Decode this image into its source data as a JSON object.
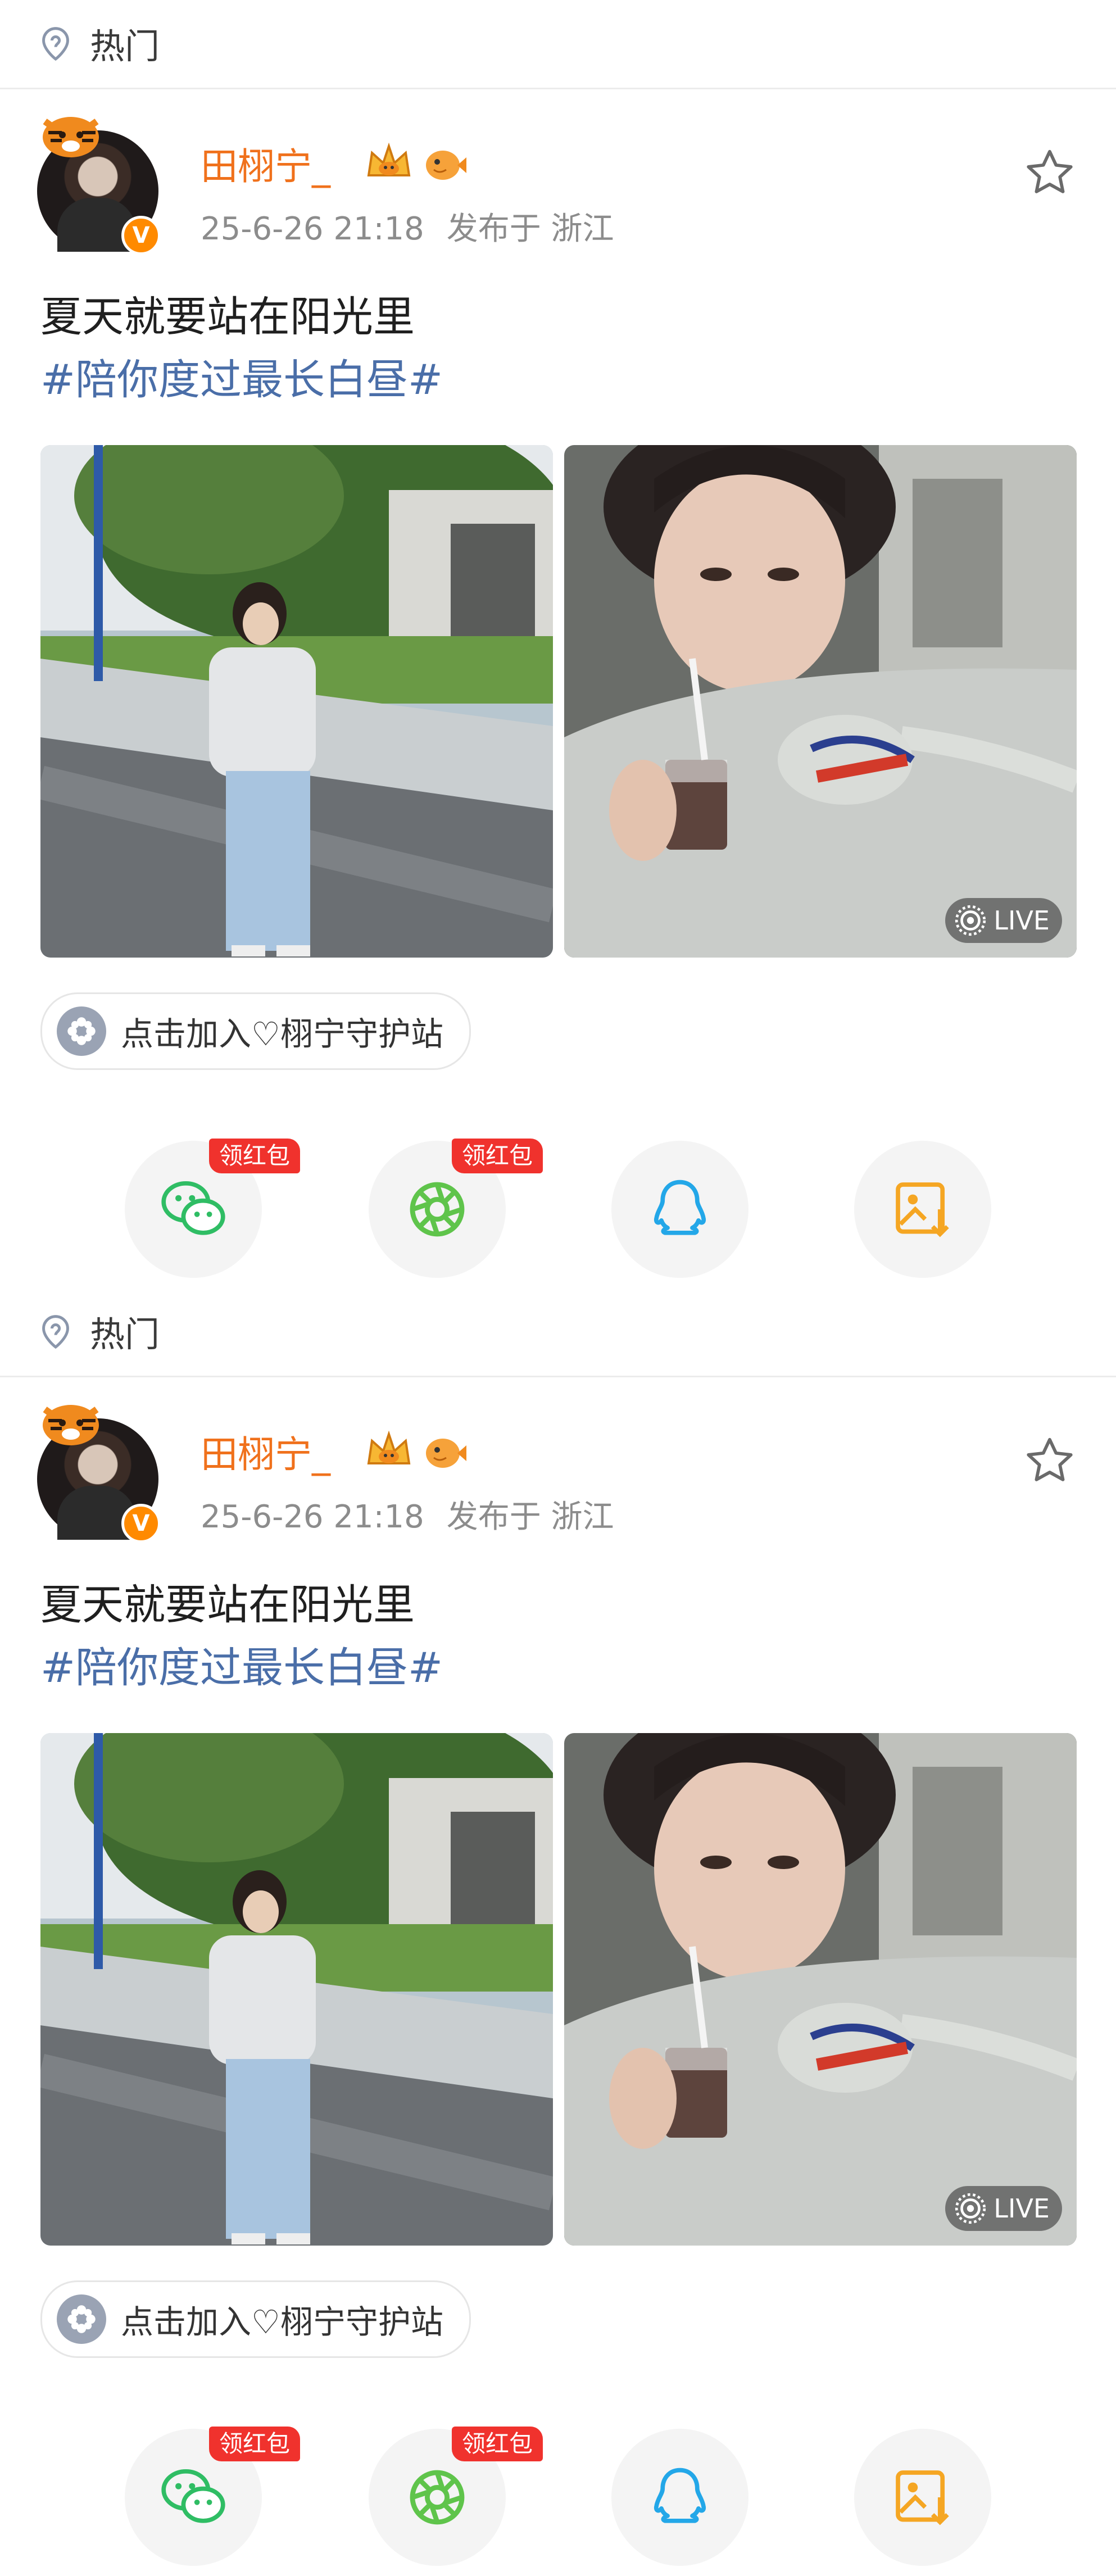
{
  "posts": [
    {
      "section_label": "热门",
      "user": {
        "name": "田栩宁_",
        "verified_badge": "V"
      },
      "meta": {
        "time": "25-6-26 21:18",
        "location": "发布于 浙江"
      },
      "content": {
        "text": "夏天就要站在阳光里",
        "hashtag": "#陪你度过最长白昼#"
      },
      "photos": [
        {
          "live": ""
        },
        {
          "live": "LIVE"
        }
      ],
      "fan_chip": "点击加入♡栩宁守护站",
      "share": [
        {
          "icon": "wechat-icon",
          "badge": "领红包"
        },
        {
          "icon": "moments-icon",
          "badge": "领红包"
        },
        {
          "icon": "qq-icon",
          "badge": ""
        },
        {
          "icon": "save-image-icon",
          "badge": ""
        }
      ]
    },
    {
      "section_label": "热门",
      "user": {
        "name": "田栩宁_",
        "verified_badge": "V"
      },
      "meta": {
        "time": "25-6-26 21:18",
        "location": "发布于 浙江"
      },
      "content": {
        "text": "夏天就要站在阳光里",
        "hashtag": "#陪你度过最长白昼#"
      },
      "photos": [
        {
          "live": ""
        },
        {
          "live": "LIVE"
        }
      ],
      "fan_chip": "点击加入♡栩宁守护站",
      "share": [
        {
          "icon": "wechat-icon",
          "badge": "领红包"
        },
        {
          "icon": "moments-icon",
          "badge": "领红包"
        },
        {
          "icon": "qq-icon",
          "badge": ""
        },
        {
          "icon": "save-image-icon",
          "badge": ""
        }
      ]
    }
  ],
  "colors": {
    "username": "#f0711c",
    "hashtag": "#4a6ea8",
    "redpack": "#f0322d",
    "verified": "#ff8a00"
  }
}
